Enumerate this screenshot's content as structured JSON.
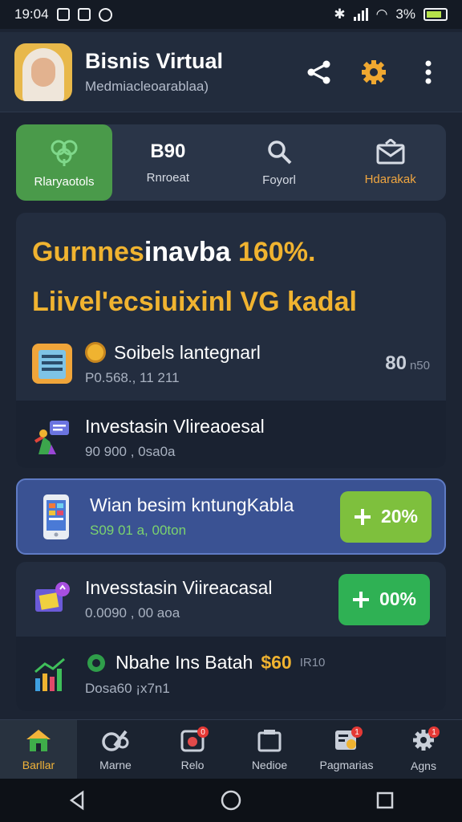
{
  "status": {
    "time": "19:04",
    "battery": "3%"
  },
  "header": {
    "title": "Bisnis Virtual",
    "subtitle": "Medmiacleoarablaa)"
  },
  "quick_tabs": [
    {
      "label": "Rlaryaotols",
      "value": ""
    },
    {
      "label": "Rnroeat",
      "value": "B90"
    },
    {
      "label": "Foyorl",
      "value": ""
    },
    {
      "label": "Hdarakak",
      "value": ""
    }
  ],
  "headline": {
    "line1_a": "Gurnnes",
    "line1_b": "inavba",
    "line1_c": "160%.",
    "line2": "Liivel'ecsiuixinl VG kadal"
  },
  "rows": [
    {
      "title": "Soibels lantegnarl",
      "sub": "P0.568., 11 211",
      "value": "80",
      "unit": "n50"
    },
    {
      "title": "Investasin Vlireaoesal",
      "sub": "90 900 , 0sa0a"
    }
  ],
  "card_highlight": {
    "title": "Wian besim kntungKabla",
    "sub": "S09 01 a, 00ton",
    "pct": "20%"
  },
  "card_bottom": [
    {
      "title": "Invesstasin Viireacasal",
      "sub": "0.0090 , 00 aoa",
      "pct": "00%"
    },
    {
      "title": "Nbahe Ins Batah",
      "value": "$60",
      "unit": "IR10",
      "sub": "Dosa60 ¡x7n1"
    }
  ],
  "nav": [
    {
      "label": "Barllar"
    },
    {
      "label": "Marne"
    },
    {
      "label": "Relo",
      "badge": "0"
    },
    {
      "label": "Nedioe"
    },
    {
      "label": "Pagmarias",
      "badge": "1"
    },
    {
      "label": "Agns",
      "badge": "1"
    }
  ]
}
